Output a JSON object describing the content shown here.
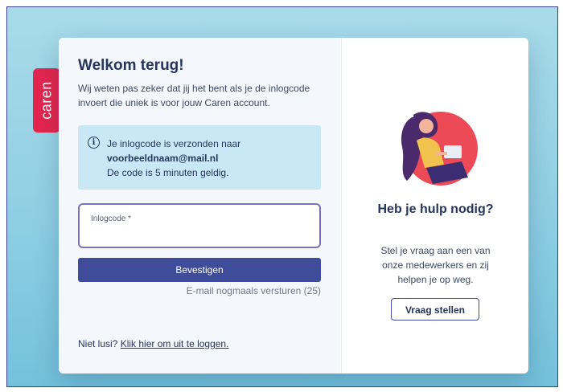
{
  "brand": {
    "name": "caren"
  },
  "login": {
    "title": "Welkom terug!",
    "intro": "Wij weten pas zeker dat jij het bent als je de inlogcode invoert die uniek is voor jouw Caren account.",
    "info": {
      "sent_text": "Je inlogcode is verzonden naar",
      "email": "voorbeeldnaam@mail.nl",
      "validity": "De code is 5 minuten geldig."
    },
    "code_field": {
      "label": "Inlogcode *",
      "value": ""
    },
    "confirm_button": "Bevestigen",
    "resend_link": "E-mail nogmaals versturen (25)",
    "logout": {
      "prefix": "Niet lusi?",
      "link": "Klik hier om uit te loggen."
    }
  },
  "help": {
    "title": "Heb je hulp nodig?",
    "text": "Stel je vraag aan een van onze medewerkers en zij helpen je op weg.",
    "button": "Vraag stellen"
  },
  "colors": {
    "brand_red": "#e3264f",
    "primary": "#3f4c99",
    "heading": "#26355e",
    "info_bg": "#c9e8f5",
    "illustration_circle": "#ec4a57"
  }
}
